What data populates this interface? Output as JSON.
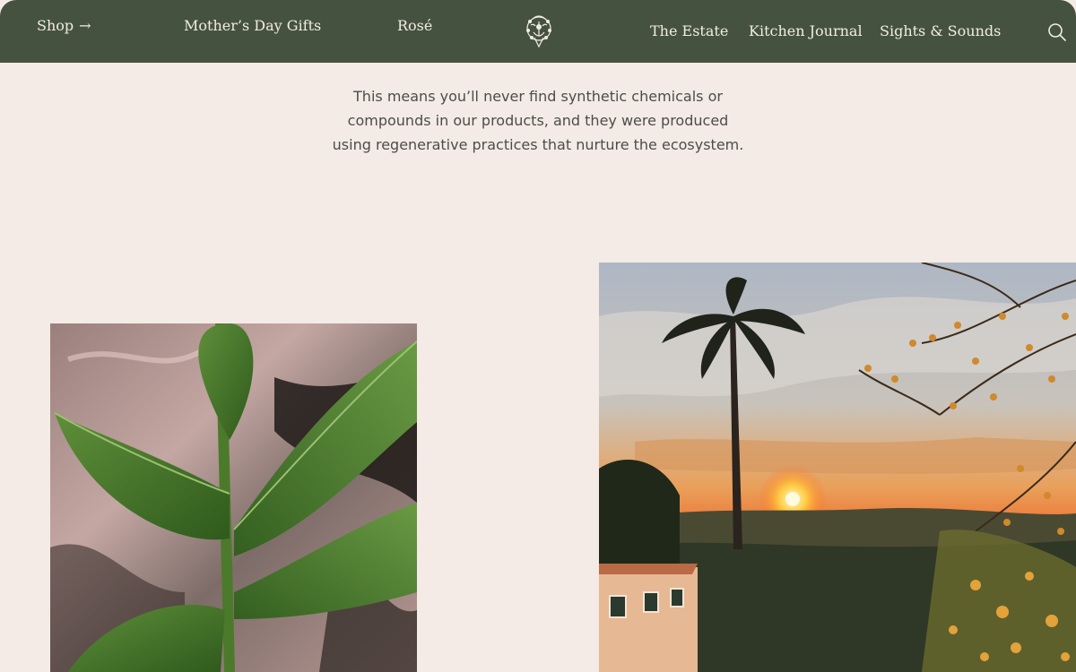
{
  "nav": {
    "shop": "Shop",
    "shop_arrow": "→",
    "mothers_day": "Mother’s Day Gifts",
    "rose": "Rosé",
    "estate": "The Estate",
    "kitchen_journal": "Kitchen Journal",
    "sights_sounds": "Sights & Sounds",
    "search_icon": "search-icon",
    "logo_icon": "crest-logo-icon"
  },
  "content": {
    "intro_text": "This means you’ll never find synthetic chemicals or compounds in our products, and they were produced using regenerative practices that nurture the ecosystem."
  },
  "colors": {
    "header_bg": "#465240",
    "page_bg": "#f4ebe6",
    "text": "#4c4d49"
  }
}
